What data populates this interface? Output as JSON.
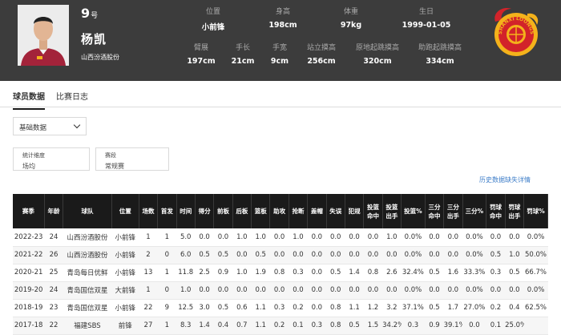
{
  "player": {
    "number": "9",
    "number_suffix": "号",
    "name": "杨凯",
    "team": "山西汾酒股份"
  },
  "profile_row1": [
    {
      "label": "位置",
      "value": "小前锋"
    },
    {
      "label": "身高",
      "value": "198cm"
    },
    {
      "label": "体重",
      "value": "97kg"
    },
    {
      "label": "生日",
      "value": "1999-01-05"
    }
  ],
  "profile_row2": [
    {
      "label": "臂展",
      "value": "197cm"
    },
    {
      "label": "手长",
      "value": "21cm"
    },
    {
      "label": "手宽",
      "value": "9cm"
    },
    {
      "label": "站立摸高",
      "value": "256cm"
    },
    {
      "label": "原地起跳摸高",
      "value": "320cm"
    },
    {
      "label": "助跑起跳摸高",
      "value": "334cm"
    }
  ],
  "logo": {
    "text": "SHANXI LOONGS",
    "colors": {
      "red": "#d2232a",
      "gold": "#f4b21b"
    }
  },
  "tabs": [
    {
      "label": "球员数据",
      "active": true
    },
    {
      "label": "比赛日志",
      "active": false
    }
  ],
  "filters": {
    "data_type": "基础数据",
    "dimension_label": "统计维度",
    "dimension_value": "场均",
    "stage_label": "赛段",
    "stage_value": "常规赛"
  },
  "history_link": "历史数据缺失详情",
  "table": {
    "headers": [
      "赛季",
      "年龄",
      "球队",
      "位置",
      "场数",
      "首发",
      "时间",
      "得分",
      "前板",
      "后板",
      "篮板",
      "助攻",
      "抢断",
      "盖帽",
      "失误",
      "犯规",
      "投篮命中",
      "投篮出手",
      "投篮%",
      "三分命中",
      "三分出手",
      "三分%",
      "罚球命中",
      "罚球出手",
      "罚球%"
    ],
    "rows": [
      [
        "2022-23",
        "24",
        "山西汾酒股份",
        "小前锋",
        "1",
        "1",
        "5.0",
        "0.0",
        "0.0",
        "1.0",
        "1.0",
        "0.0",
        "1.0",
        "0.0",
        "0.0",
        "0.0",
        "0.0",
        "1.0",
        "0.0%",
        "0.0",
        "0.0",
        "0.0%",
        "0.0",
        "0.0",
        "0.0%"
      ],
      [
        "2021-22",
        "26",
        "山西汾酒股份",
        "小前锋",
        "2",
        "0",
        "6.0",
        "0.5",
        "0.5",
        "0.0",
        "0.5",
        "0.0",
        "0.0",
        "0.0",
        "0.0",
        "0.0",
        "0.0",
        "0.0",
        "0.0%",
        "0.0",
        "0.0",
        "0.0%",
        "0.5",
        "1.0",
        "50.0%"
      ],
      [
        "2020-21",
        "25",
        "青岛每日优鲜",
        "小前锋",
        "13",
        "1",
        "11.8",
        "2.5",
        "0.9",
        "1.0",
        "1.9",
        "0.8",
        "0.3",
        "0.0",
        "0.5",
        "1.4",
        "0.8",
        "2.6",
        "32.4%",
        "0.5",
        "1.6",
        "33.3%",
        "0.3",
        "0.5",
        "66.7%"
      ],
      [
        "2019-20",
        "24",
        "青岛国信双星",
        "大前锋",
        "1",
        "0",
        "1.0",
        "0.0",
        "0.0",
        "0.0",
        "0.0",
        "0.0",
        "0.0",
        "0.0",
        "0.0",
        "0.0",
        "0.0",
        "0.0",
        "0.0%",
        "0.0",
        "0.0",
        "0.0%",
        "0.0",
        "0.0",
        "0.0%"
      ],
      [
        "2018-19",
        "23",
        "青岛国信双星",
        "小前锋",
        "22",
        "9",
        "12.5",
        "3.0",
        "0.5",
        "0.6",
        "1.1",
        "0.3",
        "0.2",
        "0.0",
        "0.8",
        "1.1",
        "1.2",
        "3.2",
        "37.1%",
        "0.5",
        "1.7",
        "27.0%",
        "0.2",
        "0.4",
        "62.5%"
      ],
      [
        "2017-18",
        "22",
        "福建SBS",
        "前锋",
        "27",
        "1",
        "8.3",
        "1.4",
        "0.4",
        "0.7",
        "1.1",
        "0.2",
        "0.1",
        "0.3",
        "0.8",
        "0.5",
        "1.5",
        "34.2%",
        "0.3",
        "0.9",
        "39.1%",
        "0.0",
        "0.1",
        "25.0%",
        ""
      ]
    ]
  }
}
